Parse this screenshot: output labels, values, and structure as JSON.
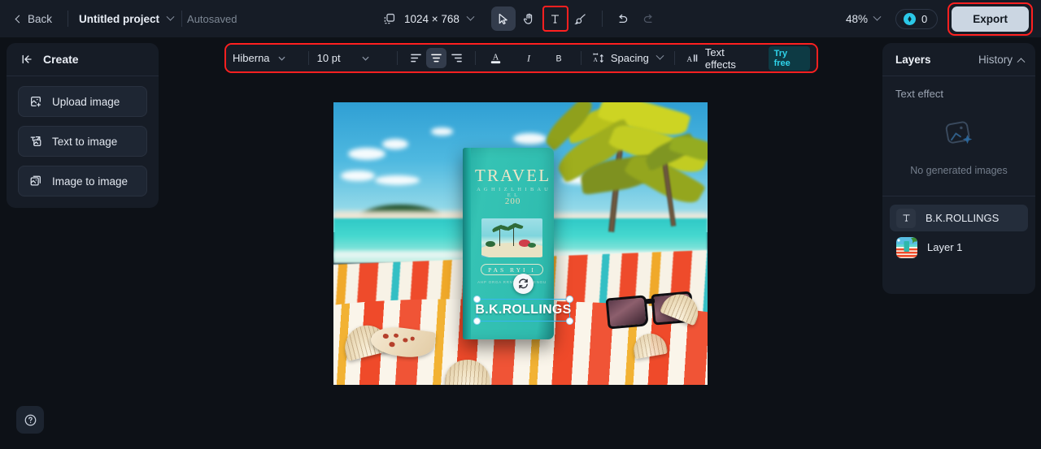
{
  "topbar": {
    "back_label": "Back",
    "project_name": "Untitled project",
    "autosaved_label": "Autosaved",
    "canvas_size": "1024 × 768",
    "zoom_level": "48%",
    "credits_count": "0",
    "export_label": "Export",
    "tools": [
      {
        "name": "select-tool",
        "icon": "cursor-arrow-icon",
        "active": true
      },
      {
        "name": "hand-tool",
        "icon": "hand-icon",
        "active": false
      },
      {
        "name": "text-tool",
        "icon": "text-t-icon",
        "active": false
      },
      {
        "name": "brush-tool",
        "icon": "brush-icon",
        "active": false
      },
      {
        "name": "undo",
        "icon": "undo-arrow-icon",
        "active": false
      },
      {
        "name": "redo",
        "icon": "redo-arrow-icon",
        "active": false
      }
    ],
    "accent_highlight_color": "#ff2020",
    "credit_icon_color": "#2bc8e8"
  },
  "text_toolbar": {
    "font_family": "Hiberna",
    "font_size": "10 pt",
    "align_left_label": "Align left",
    "align_center_label": "Align center",
    "align_right_label": "Align right",
    "text_color_label": "Text color",
    "italic_label": "I",
    "bold_label": "B",
    "spacing_label": "Spacing",
    "text_effects_label": "Text effects",
    "try_free_badge": "Try free",
    "active_alignment": "center",
    "badge_color": "#2fd3ea"
  },
  "left_panel": {
    "header": "Create",
    "collapse_icon": "collapse-left-icon",
    "items": [
      {
        "label": "Upload image",
        "icon": "upload-image-icon"
      },
      {
        "label": "Text to image",
        "icon": "text-to-image-icon"
      },
      {
        "label": "Image to image",
        "icon": "image-to-image-icon"
      }
    ],
    "help_icon": "question-mark-icon"
  },
  "right_panel": {
    "layers_tab": "Layers",
    "history_tab": "History",
    "section_title": "Text effect",
    "empty_state": "No generated images",
    "empty_icon": "image-sparkle-icon",
    "layers": [
      {
        "label": "B.K.ROLLINGS",
        "type": "text",
        "selected": true
      },
      {
        "label": "Layer 1",
        "type": "image",
        "selected": false
      }
    ]
  },
  "canvas": {
    "book_title": "TRAVEL",
    "book_subtitle": "A G H I Z L H  I  B A U E L",
    "book_year": "200",
    "book_badge": "PAS      RYI I",
    "book_fine_print": "AHP                ORGA\nRRNTOU        RRTENGU",
    "overlay_text": "B.K.ROLLINGS",
    "selection_color": "#37b7f0",
    "rotate_icon": "rotate-refresh-icon"
  }
}
